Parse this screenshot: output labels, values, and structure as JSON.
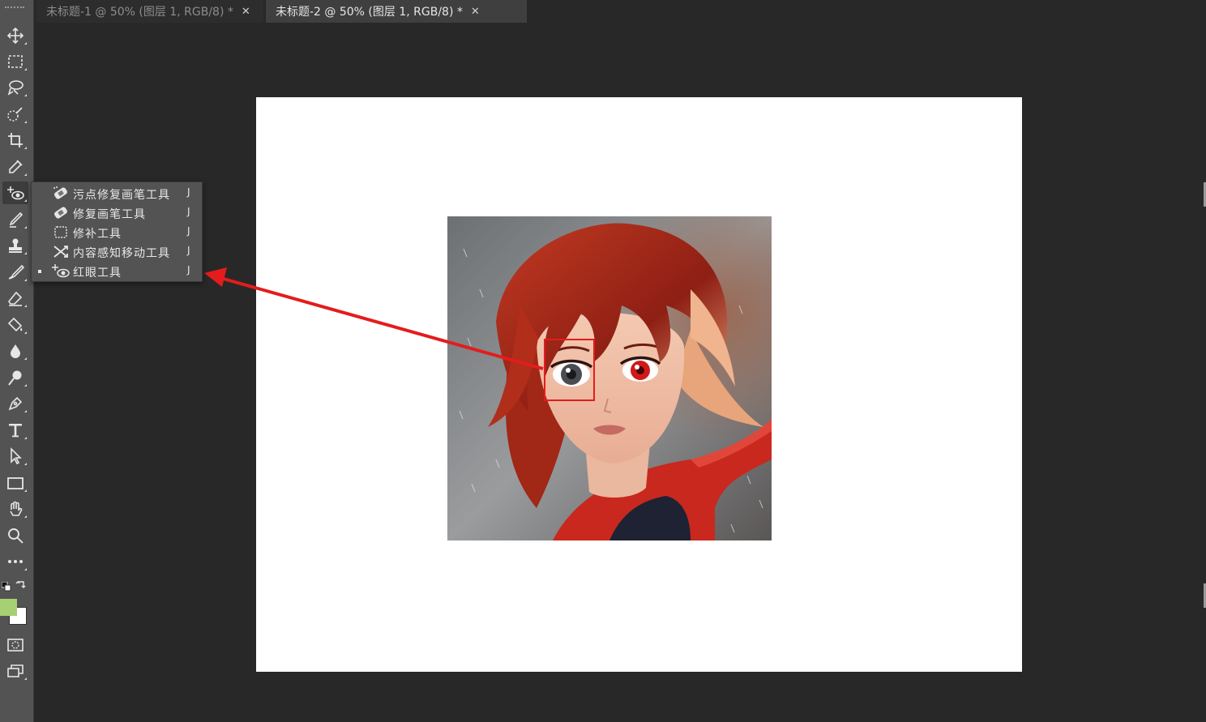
{
  "tabs": [
    {
      "label": "未标题-1 @ 50% (图层 1, RGB/8) *",
      "close": "✕",
      "active": false
    },
    {
      "label": "未标题-2 @ 50% (图层 1, RGB/8) *",
      "close": "✕",
      "active": true
    }
  ],
  "toolbar": {
    "tools": [
      {
        "name": "move-tool",
        "icon": "move-icon"
      },
      {
        "name": "marquee-tool",
        "icon": "rect-marquee-icon"
      },
      {
        "name": "lasso-tool",
        "icon": "lasso-icon"
      },
      {
        "name": "quick-select-tool",
        "icon": "quick-select-icon"
      },
      {
        "name": "crop-tool",
        "icon": "crop-icon"
      },
      {
        "name": "eyedropper-tool",
        "icon": "eyedropper-icon"
      },
      {
        "name": "red-eye-tool",
        "icon": "red-eye-icon"
      },
      {
        "name": "brush-tool",
        "icon": "brush-icon"
      },
      {
        "name": "stamp-tool",
        "icon": "stamp-icon"
      },
      {
        "name": "history-brush-tool",
        "icon": "history-brush-icon"
      },
      {
        "name": "eraser-tool",
        "icon": "eraser-icon"
      },
      {
        "name": "paint-bucket-tool",
        "icon": "paint-bucket-icon"
      },
      {
        "name": "blur-tool",
        "icon": "drop-icon"
      },
      {
        "name": "dodge-tool",
        "icon": "dodge-icon"
      },
      {
        "name": "pen-tool",
        "icon": "pen-icon"
      },
      {
        "name": "type-tool",
        "icon": "type-icon"
      },
      {
        "name": "path-select-tool",
        "icon": "arrow-icon"
      },
      {
        "name": "rectangle-tool",
        "icon": "rectangle-icon"
      },
      {
        "name": "hand-tool",
        "icon": "hand-icon"
      },
      {
        "name": "zoom-tool",
        "icon": "zoom-icon"
      },
      {
        "name": "more-tools",
        "icon": "more-icon"
      }
    ],
    "foreground_color": "#a7cf73",
    "background_color": "#ffffff"
  },
  "flyout": {
    "items": [
      {
        "label": "污点修复画笔工具",
        "shortcut": "J",
        "icon": "spot-healing-icon",
        "selected": false
      },
      {
        "label": "修复画笔工具",
        "shortcut": "J",
        "icon": "healing-brush-icon",
        "selected": false
      },
      {
        "label": "修补工具",
        "shortcut": "J",
        "icon": "patch-icon",
        "selected": false
      },
      {
        "label": "内容感知移动工具",
        "shortcut": "J",
        "icon": "content-aware-move-icon",
        "selected": false
      },
      {
        "label": "红眼工具",
        "shortcut": "J",
        "icon": "red-eye-icon",
        "selected": true
      }
    ]
  },
  "annotation": {
    "color": "#e41c1c"
  }
}
